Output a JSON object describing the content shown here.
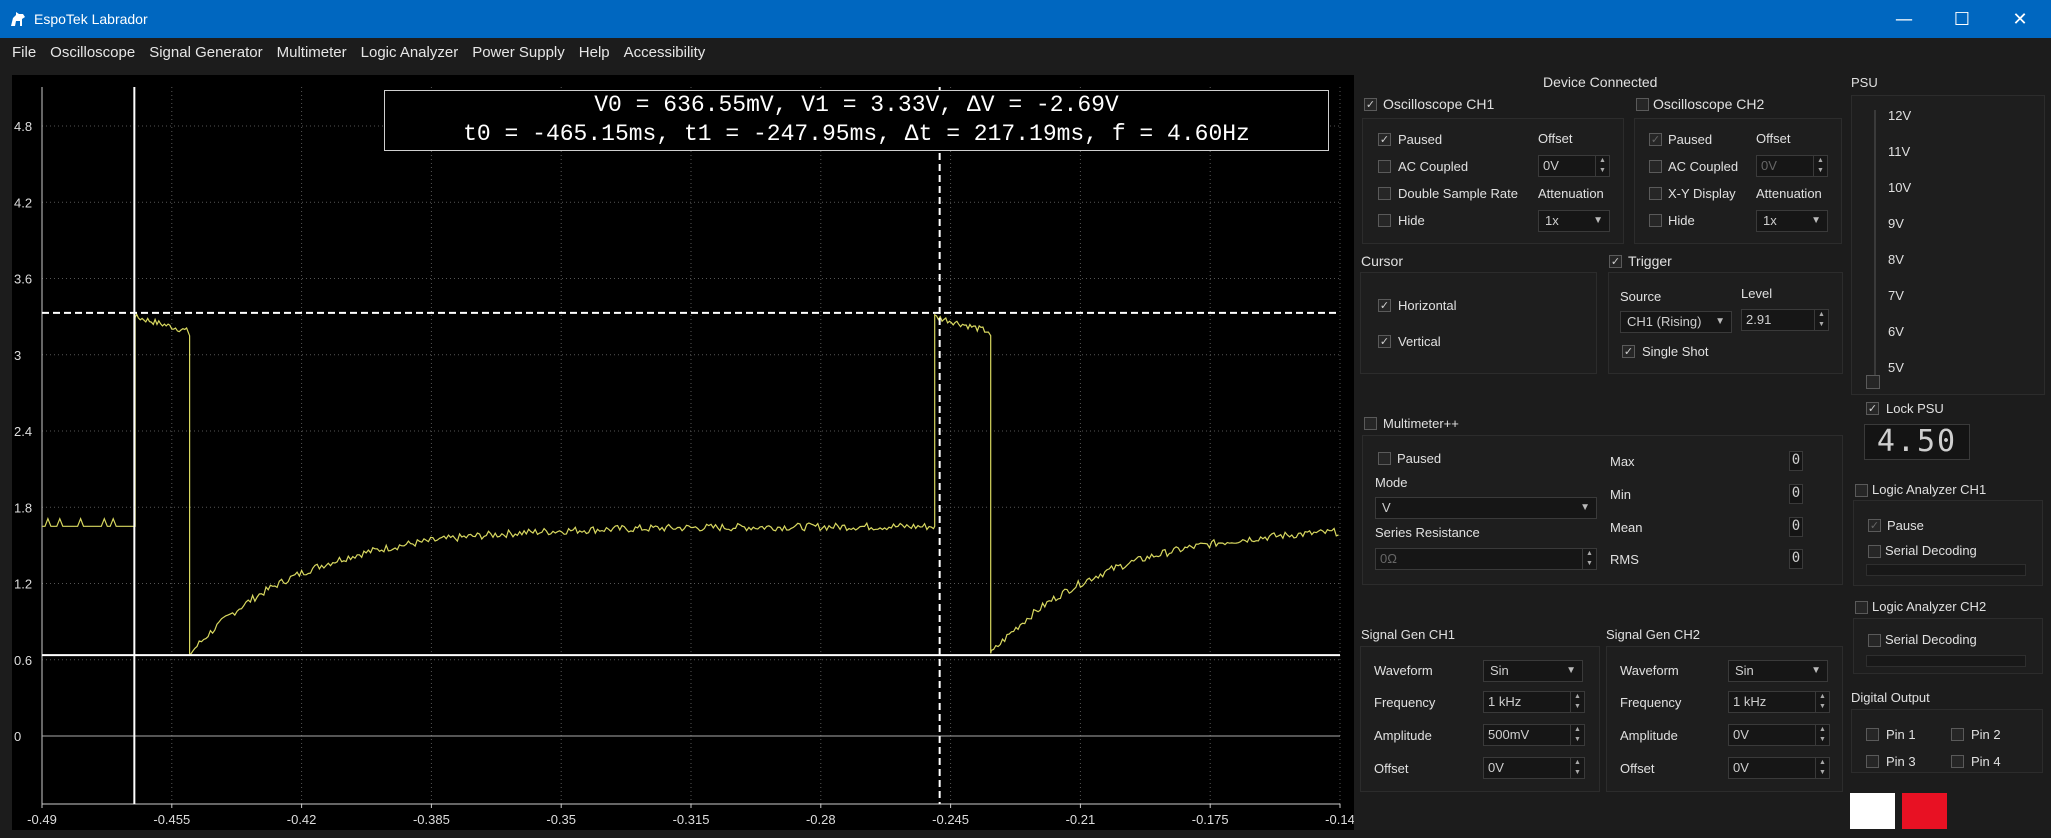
{
  "window": {
    "title": "EspoTek Labrador",
    "minimize": "—",
    "maximize": "☐",
    "close": "✕"
  },
  "menu": [
    {
      "label": "File"
    },
    {
      "label": "Oscilloscope"
    },
    {
      "label": "Signal Generator"
    },
    {
      "label": "Multimeter"
    },
    {
      "label": "Logic Analyzer"
    },
    {
      "label": "Power Supply"
    },
    {
      "label": "Help"
    },
    {
      "label": "Accessibility"
    }
  ],
  "scope": {
    "cursor_line1": "V0 = 636.55mV,  V1 = 3.33V,  ΔV = -2.69V",
    "cursor_line2": "t0 = -465.15ms, t1 = -247.95ms,  Δt = 217.19ms,  f = 4.60Hz",
    "y_ticks": [
      "4.8",
      "4.2",
      "3.6",
      "3",
      "2.4",
      "1.8",
      "1.2",
      "0.6",
      "0"
    ],
    "x_ticks": [
      "-0.49",
      "-0.455",
      "-0.42",
      "-0.385",
      "-0.35",
      "-0.315",
      "-0.28",
      "-0.245",
      "-0.21",
      "-0.175",
      "-0.14"
    ],
    "trace_color": "#d8d860",
    "cursor_color": "#ffffff"
  },
  "status": {
    "device": "Device Connected"
  },
  "osc1": {
    "title": "Oscilloscope CH1",
    "checked": "✓",
    "paused": "Paused",
    "paused_check": "✓",
    "ac_coupled": "AC Coupled",
    "double_rate": "Double Sample Rate",
    "hide": "Hide",
    "offset_label": "Offset",
    "offset_value": "0V",
    "atten_label": "Attenuation",
    "atten_value": "1x"
  },
  "osc2": {
    "title": "Oscilloscope CH2",
    "paused": "Paused",
    "paused_check": "✓",
    "ac_coupled": "AC Coupled",
    "xy": "X-Y Display",
    "hide": "Hide",
    "offset_label": "Offset",
    "offset_value": "0V",
    "atten_label": "Attenuation",
    "atten_value": "1x"
  },
  "cursor": {
    "title": "Cursor",
    "horizontal": "Horizontal",
    "vertical": "Vertical",
    "check": "✓"
  },
  "trigger": {
    "title": "Trigger",
    "check": "✓",
    "source_label": "Source",
    "source_value": "CH1 (Rising)",
    "level_label": "Level",
    "level_value": "2.91",
    "single_shot": "Single Shot"
  },
  "multimeter": {
    "title": "Multimeter++",
    "paused": "Paused",
    "mode_label": "Mode",
    "mode_value": "V",
    "series_label": "Series Resistance",
    "series_value": "0Ω",
    "max": "Max",
    "min": "Min",
    "mean": "Mean",
    "rms": "RMS",
    "readout": "0"
  },
  "psu": {
    "title": "PSU",
    "ticks": [
      "12V",
      "11V",
      "10V",
      "9V",
      "8V",
      "7V",
      "6V",
      "5V"
    ],
    "lock": "Lock PSU",
    "check": "✓",
    "display": "4.50"
  },
  "la1": {
    "title": "Logic Analyzer CH1",
    "pause": "Pause",
    "check": "✓",
    "serial": "Serial Decoding"
  },
  "la2": {
    "title": "Logic Analyzer CH2",
    "serial": "Serial Decoding"
  },
  "siggen1": {
    "title": "Signal Gen CH1",
    "waveform_label": "Waveform",
    "waveform_value": "Sin",
    "freq_label": "Frequency",
    "freq_value": "1 kHz",
    "amp_label": "Amplitude",
    "amp_value": "500mV",
    "offset_label": "Offset",
    "offset_value": "0V"
  },
  "siggen2": {
    "title": "Signal Gen CH2",
    "waveform_label": "Waveform",
    "waveform_value": "Sin",
    "freq_label": "Frequency",
    "freq_value": "1 kHz",
    "amp_label": "Amplitude",
    "amp_value": "0V",
    "offset_label": "Offset",
    "offset_value": "0V"
  },
  "digital": {
    "title": "Digital Output",
    "pin1": "Pin 1",
    "pin2": "Pin 2",
    "pin3": "Pin 3",
    "pin4": "Pin 4"
  },
  "swatches": {
    "bg": "#ffffff",
    "trace": "#e81123"
  }
}
